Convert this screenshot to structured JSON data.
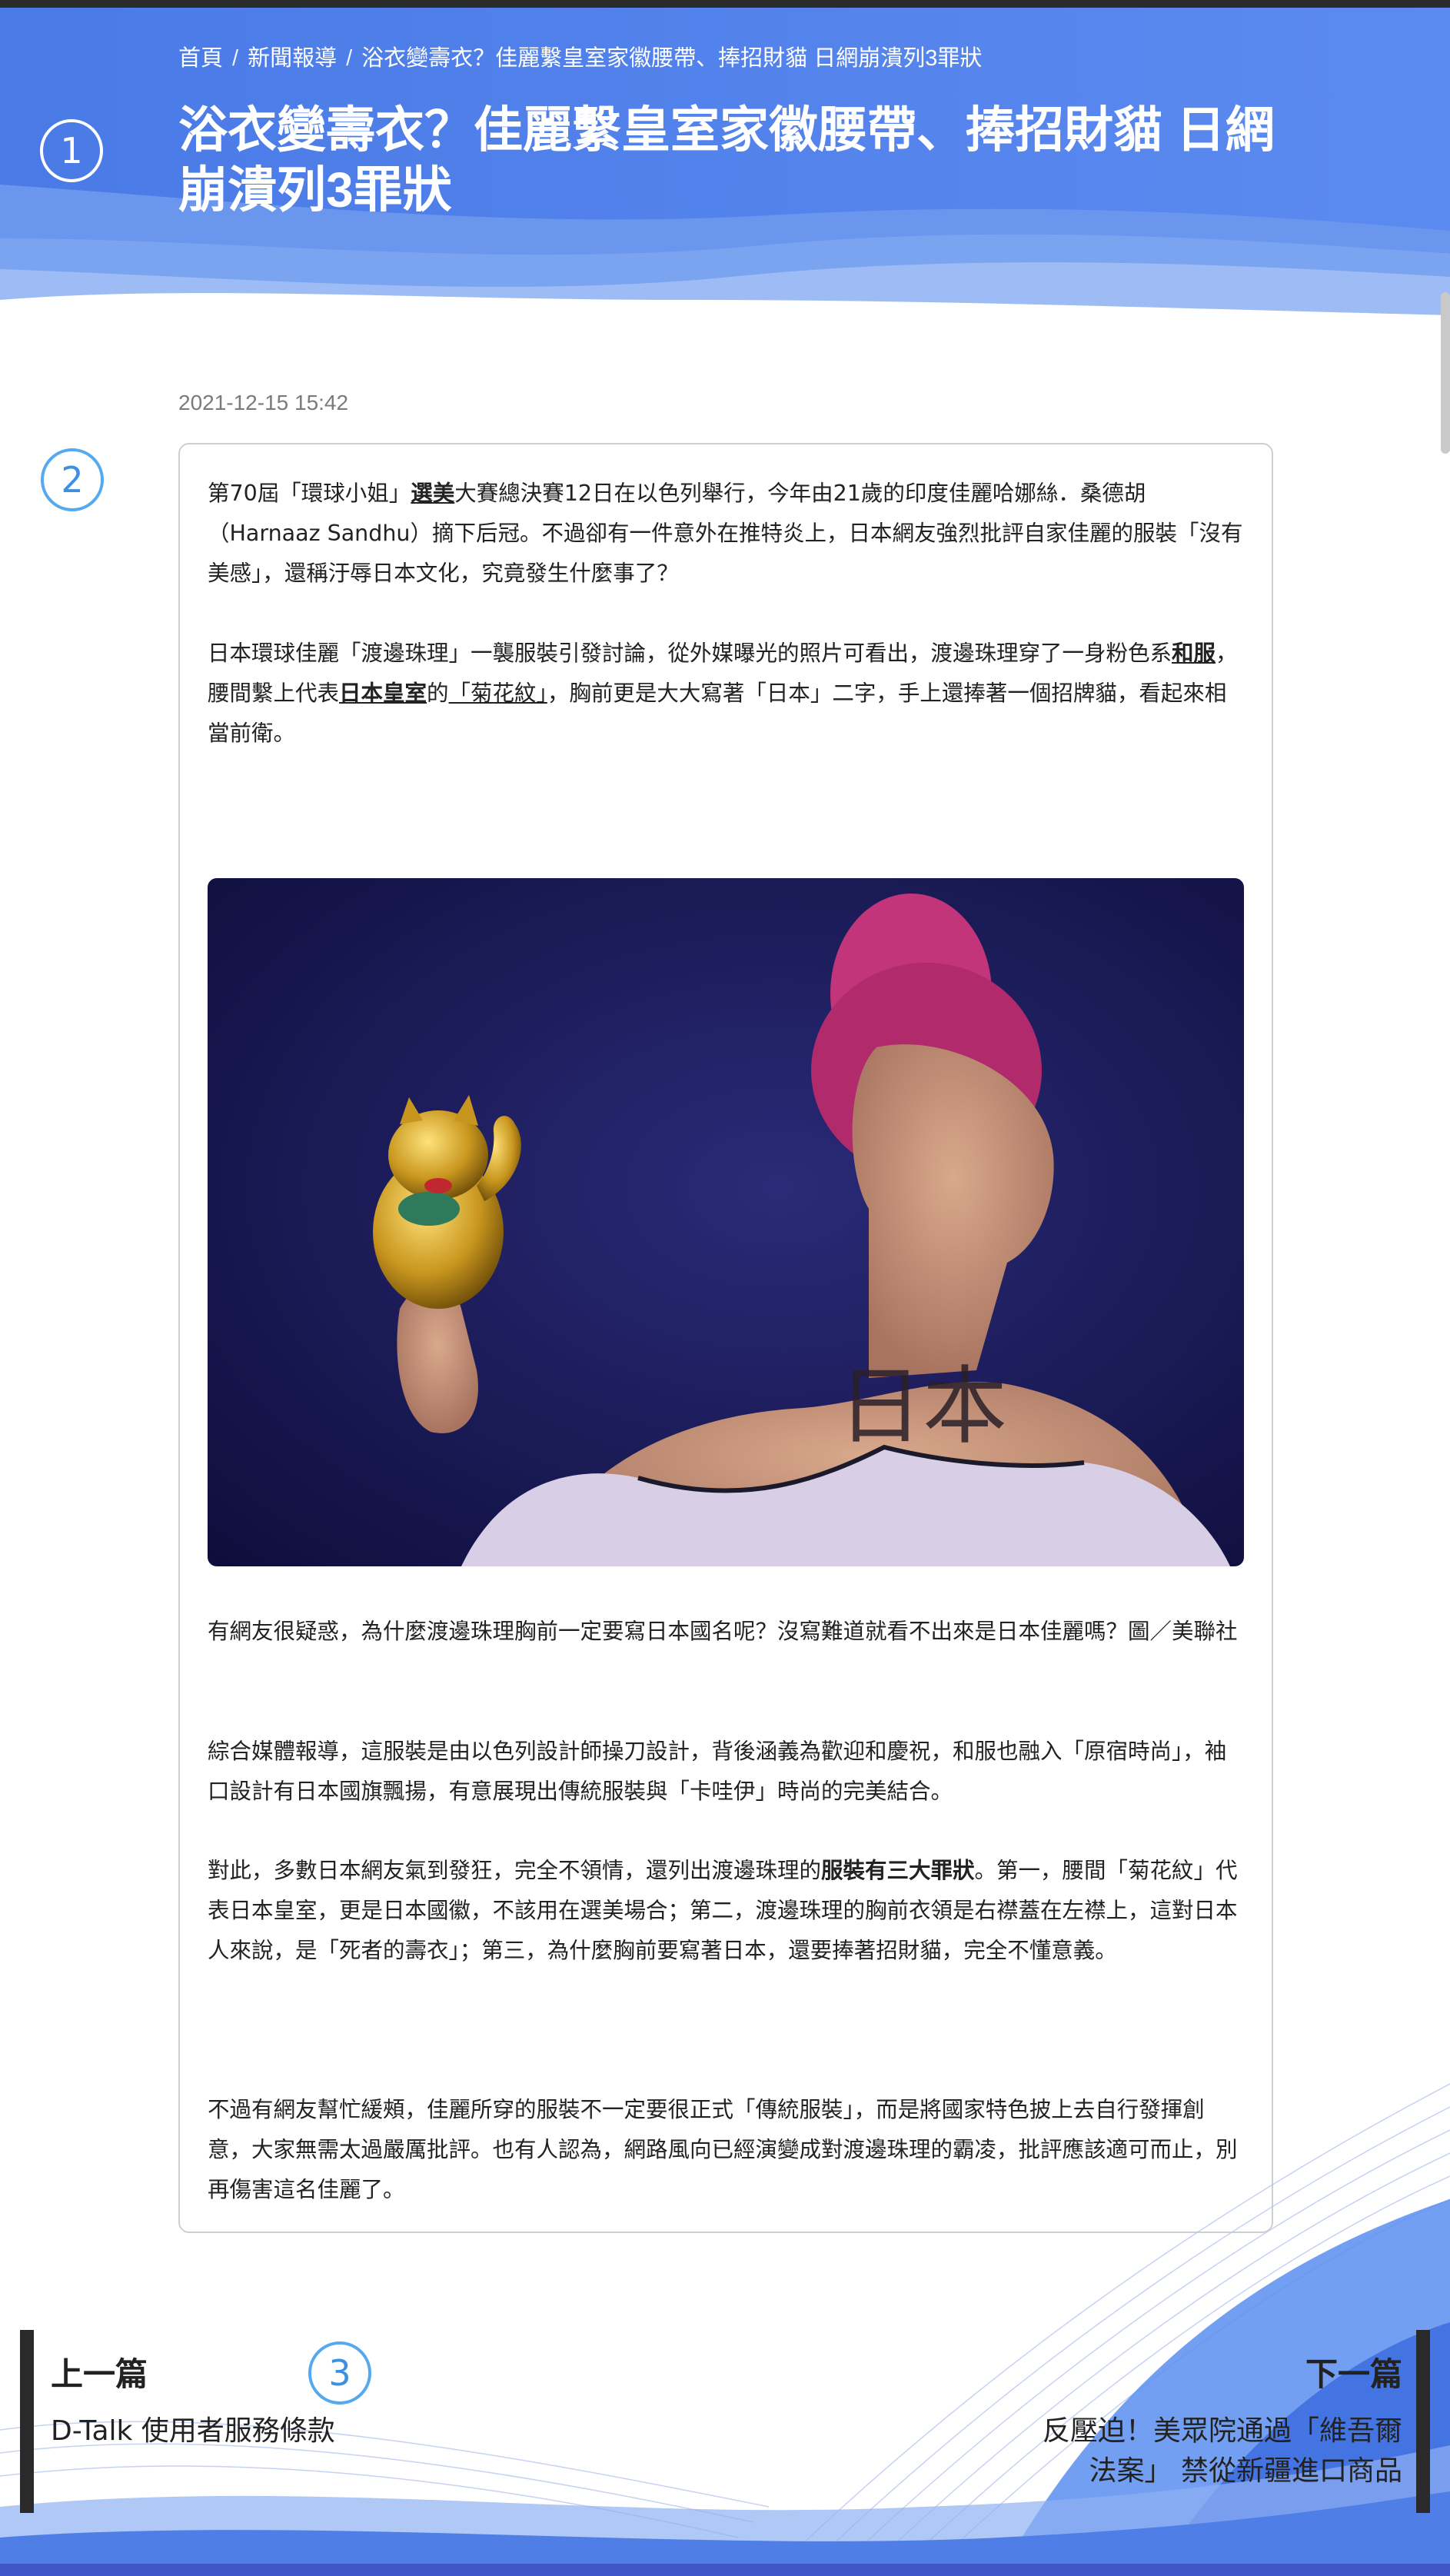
{
  "breadcrumb": {
    "home": "首頁",
    "section": "新聞報導",
    "current": "浴衣變壽衣？佳麗繫皇室家徽腰帶、捧招財貓 日網崩潰列3罪狀",
    "separator": "/"
  },
  "article": {
    "title": "浴衣變壽衣？佳麗繫皇室家徽腰帶、捧招財貓 日網崩潰列3罪狀",
    "date": "2021-12-15 15:42",
    "p1": {
      "before": "第70屆「環球小姐」",
      "link": "選美",
      "after": "大賽總決賽12日在以色列舉行，今年由21歲的印度佳麗哈娜絲．桑德胡（Harnaaz Sandhu）摘下后冠。不過卻有一件意外在推特炎上，日本網友強烈批評自家佳麗的服裝「沒有美感」，還稱汙辱日本文化，究竟發生什麼事了？"
    },
    "p2": {
      "t1": "日本環球佳麗「渡邊珠理」一襲服裝引發討論，從外媒曝光的照片可看出，渡邊珠理穿了一身粉色系",
      "link1": "和服",
      "t2": "，腰間繫上代表",
      "link2": "日本皇室",
      "t3": "的",
      "link3": "「菊花紋」",
      "t4": "，胸前更是大大寫著「日本」二字，手上還捧著一個招牌貓，看起來相當前衛。"
    },
    "photo_text": "日本",
    "caption": "有網友很疑惑，為什麼渡邊珠理胸前一定要寫日本國名呢？沒寫難道就看不出來是日本佳麗嗎？圖／美聯社",
    "p3": "綜合媒體報導，這服裝是由以色列設計師操刀設計，背後涵義為歡迎和慶祝，和服也融入「原宿時尚」，袖口設計有日本國旗飄揚，有意展現出傳統服裝與「卡哇伊」時尚的完美結合。",
    "p4": {
      "before": "對此，多數日本網友氣到發狂，完全不領情，還列出渡邊珠理的",
      "bold": "服裝有三大罪狀",
      "after": "。第一，腰間「菊花紋」代表日本皇室，更是日本國徽，不該用在選美場合；第二，渡邊珠理的胸前衣領是右襟蓋在左襟上，這對日本人來說，是「死者的壽衣」；第三，為什麼胸前要寫著日本，還要捧著招財貓，完全不懂意義。"
    },
    "p5": "不過有網友幫忙緩頰，佳麗所穿的服裝不一定要很正式「傳統服裝」，而是將國家特色披上去自行發揮創意，大家無需太過嚴厲批評。也有人認為，網路風向已經演變成對渡邊珠理的霸凌，批評應該適可而止，別再傷害這名佳麗了。"
  },
  "nav": {
    "prev_label": "上一篇",
    "prev_title": "D-Talk 使用者服務條款",
    "next_label": "下一篇",
    "next_title_line1": "反壓迫！美眾院通過「維吾爾",
    "next_title_line2": "法案」 禁從新疆進口商品"
  },
  "markers": {
    "m1": "1",
    "m2": "2",
    "m3": "3"
  },
  "colors": {
    "header_blue": "#4d7be6",
    "wave_light": "#9dbcf5",
    "marker_blue": "#55a9ee",
    "text": "#222222",
    "date_gray": "#7b7b7b"
  }
}
